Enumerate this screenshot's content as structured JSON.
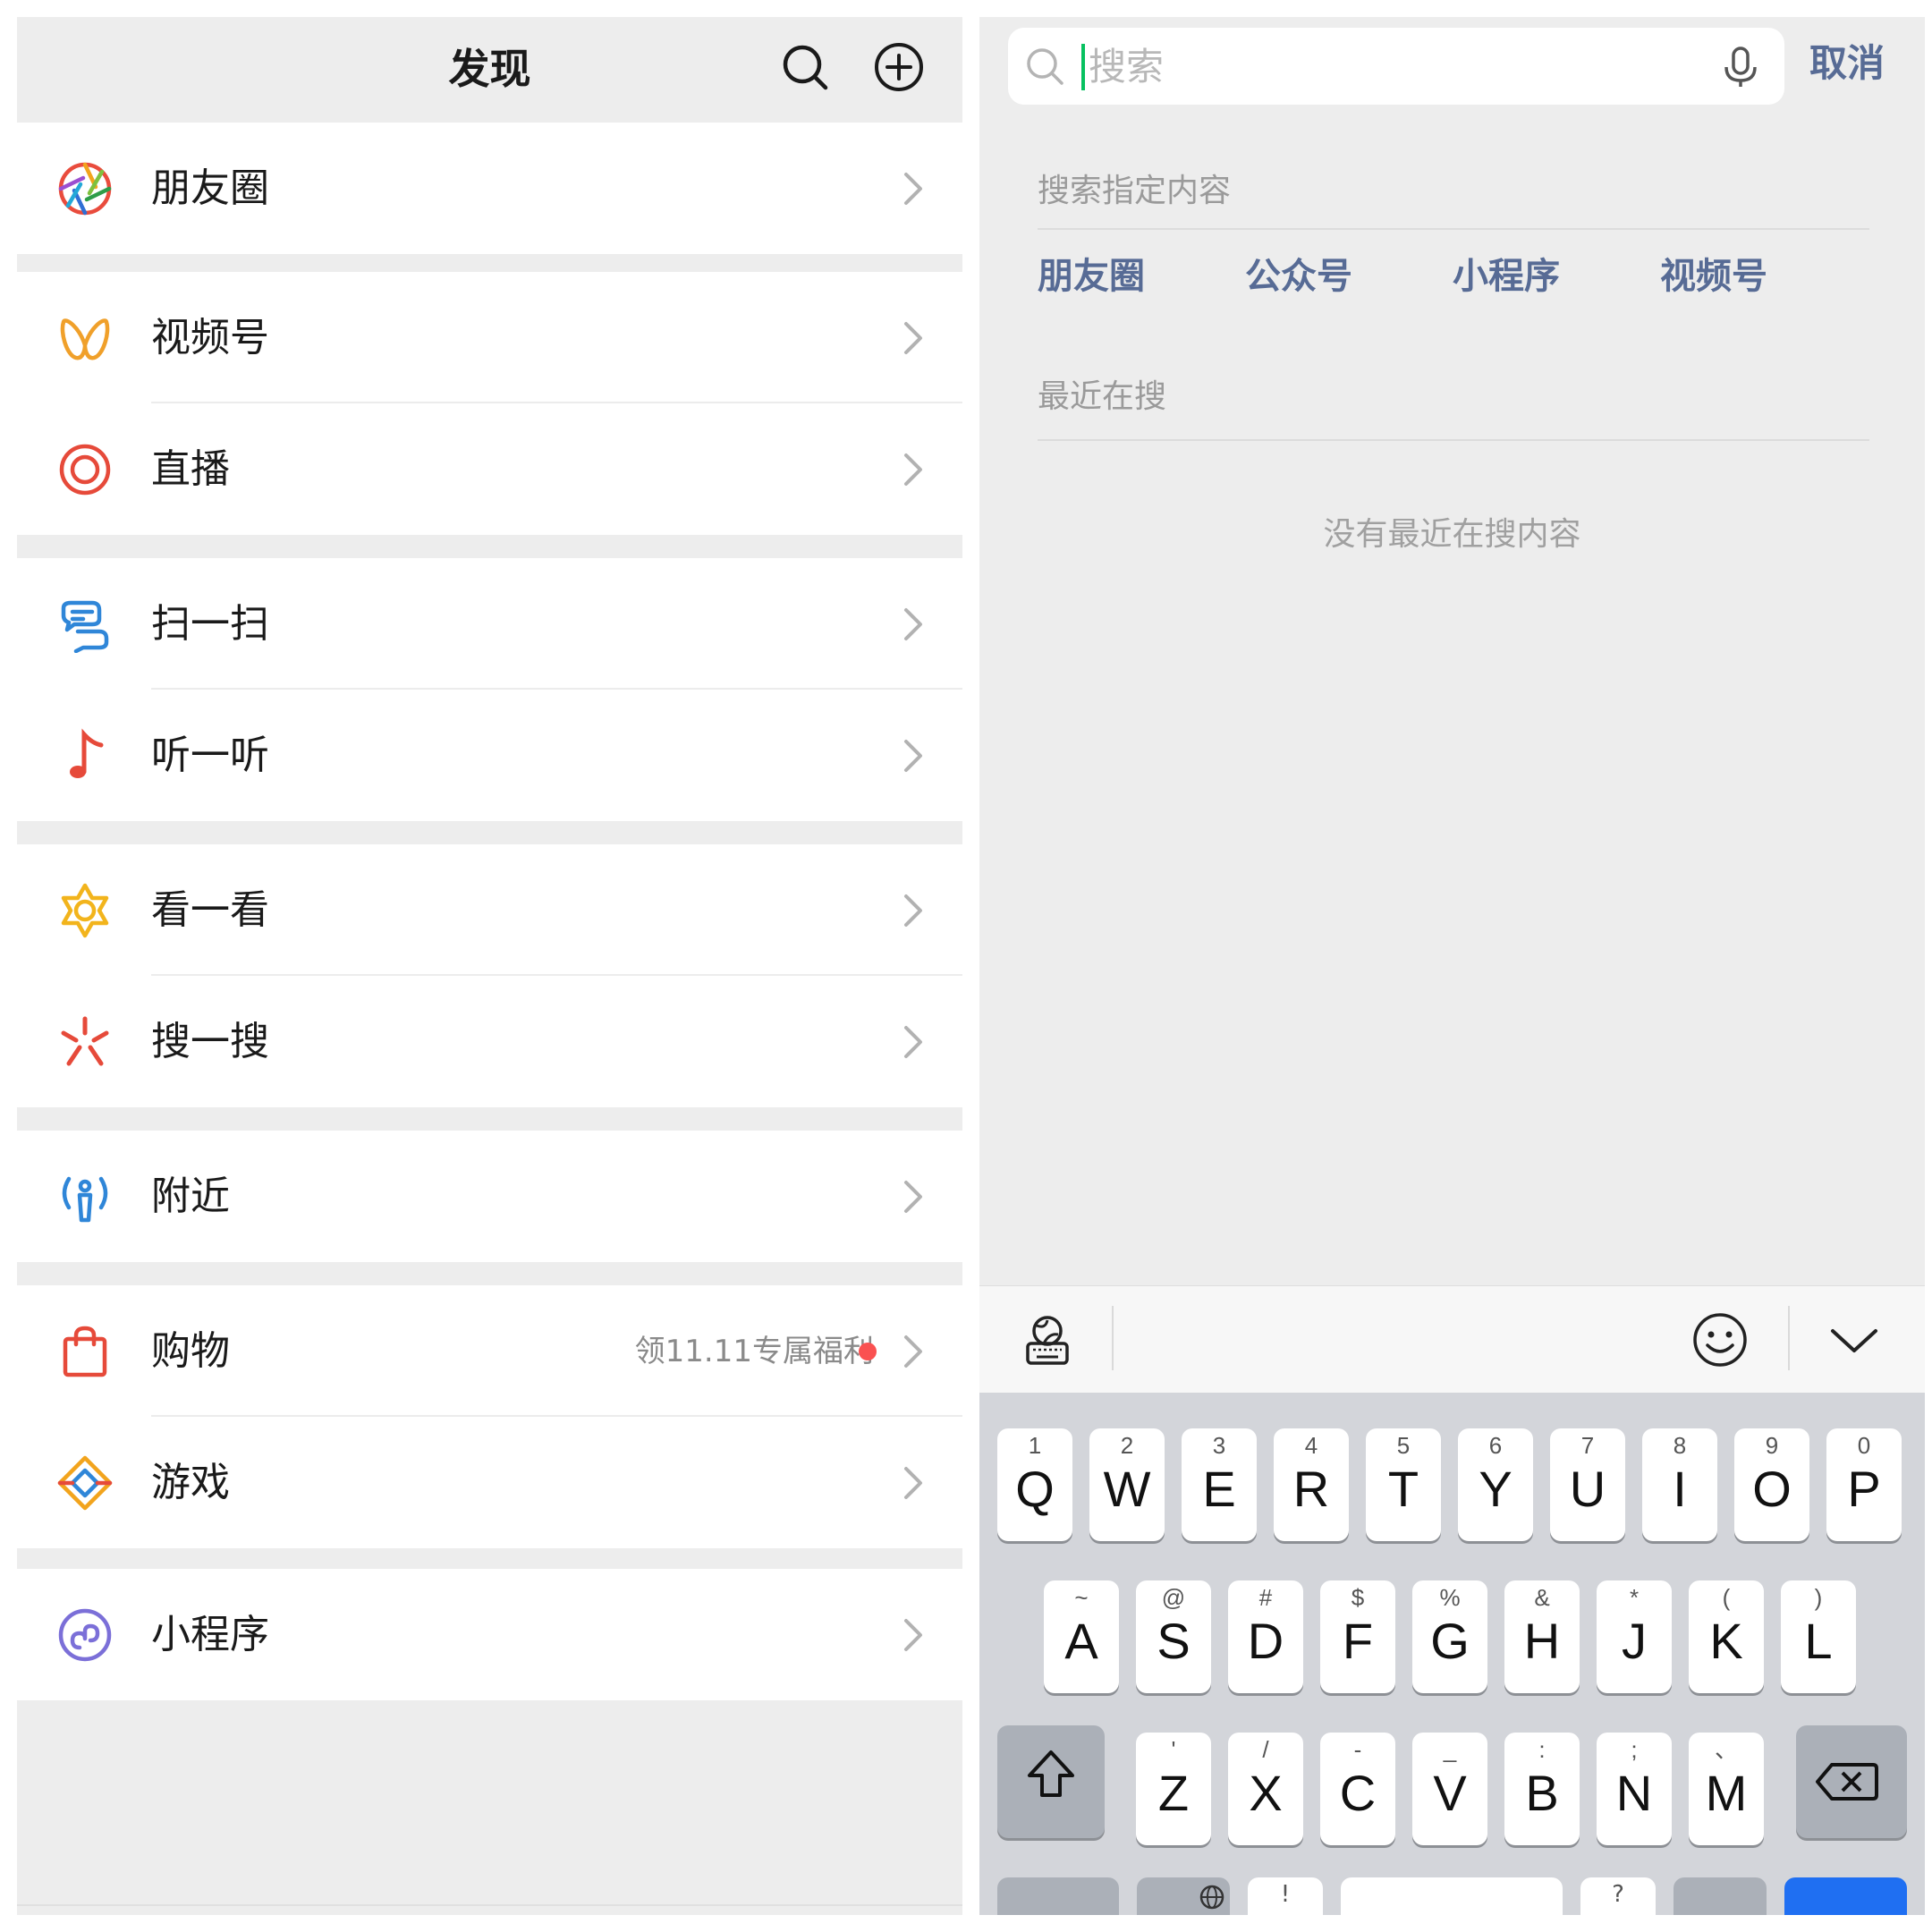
{
  "discover": {
    "title": "发现",
    "header_icons": [
      "search-icon",
      "add-circle-icon"
    ],
    "groups": [
      [
        {
          "label": "朋友圈",
          "icon": "moments-shutter-icon"
        }
      ],
      [
        {
          "label": "视频号",
          "icon": "channels-butterfly-icon"
        },
        {
          "label": "直播",
          "icon": "live-circle-icon"
        }
      ],
      [
        {
          "label": "扫一扫",
          "icon": "scan-icon"
        },
        {
          "label": "听一听",
          "icon": "music-note-icon"
        }
      ],
      [
        {
          "label": "看一看",
          "icon": "top-stories-icon"
        },
        {
          "label": "搜一搜",
          "icon": "search-spark-icon"
        }
      ],
      [
        {
          "label": "附近",
          "icon": "nearby-icon"
        }
      ],
      [
        {
          "label": "购物",
          "icon": "shopping-bag-icon",
          "promo": "领11.11专属福利",
          "badge": true
        },
        {
          "label": "游戏",
          "icon": "game-diamond-icon"
        }
      ],
      [
        {
          "label": "小程序",
          "icon": "mini-program-icon"
        }
      ]
    ]
  },
  "search": {
    "placeholder": "搜索",
    "value": "",
    "cancel": "取消",
    "specific_title": "搜索指定内容",
    "shortcuts": [
      "朋友圈",
      "公众号",
      "小程序",
      "视频号"
    ],
    "recent_title": "最近在搜",
    "recent_empty": "没有最近在搜内容"
  },
  "keyboard": {
    "toolbar_icons": [
      "keyboard-settings-icon",
      "emoji-icon",
      "collapse-chevron-icon"
    ],
    "row1": [
      {
        "letter": "Q",
        "sub": "1"
      },
      {
        "letter": "W",
        "sub": "2"
      },
      {
        "letter": "E",
        "sub": "3"
      },
      {
        "letter": "R",
        "sub": "4"
      },
      {
        "letter": "T",
        "sub": "5"
      },
      {
        "letter": "Y",
        "sub": "6"
      },
      {
        "letter": "U",
        "sub": "7"
      },
      {
        "letter": "I",
        "sub": "8"
      },
      {
        "letter": "O",
        "sub": "9"
      },
      {
        "letter": "P",
        "sub": "0"
      }
    ],
    "row2": [
      {
        "letter": "A",
        "sub": "~"
      },
      {
        "letter": "S",
        "sub": "@"
      },
      {
        "letter": "D",
        "sub": "#"
      },
      {
        "letter": "F",
        "sub": "$"
      },
      {
        "letter": "G",
        "sub": "%"
      },
      {
        "letter": "H",
        "sub": "&"
      },
      {
        "letter": "J",
        "sub": "*"
      },
      {
        "letter": "K",
        "sub": "("
      },
      {
        "letter": "L",
        "sub": ")"
      }
    ],
    "row3": [
      {
        "letter": "Z",
        "sub": "'"
      },
      {
        "letter": "X",
        "sub": "/"
      },
      {
        "letter": "C",
        "sub": "-"
      },
      {
        "letter": "V",
        "sub": "_"
      },
      {
        "letter": "B",
        "sub": ":"
      },
      {
        "letter": "N",
        "sub": ";"
      },
      {
        "letter": "M",
        "sub": "、"
      }
    ],
    "row4_labels": [
      "!",
      "?"
    ]
  },
  "colors": {
    "accent_link": "#576b95",
    "caret": "#07c160",
    "badge": "#fa5151",
    "keyboard_blue": "#1f6ff2"
  }
}
